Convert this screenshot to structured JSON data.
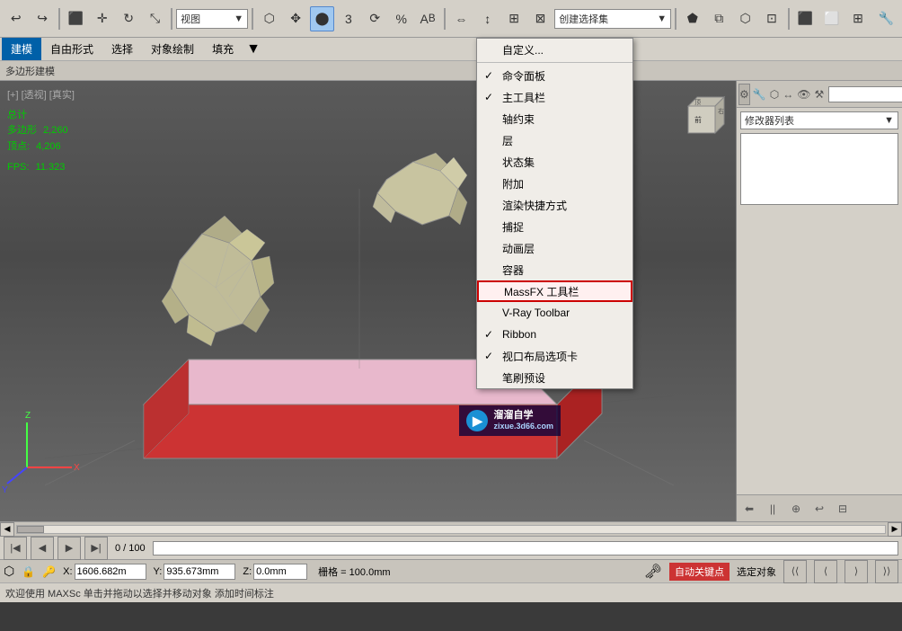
{
  "topToolbar": {
    "viewDropdown": "视图",
    "createDropdown": "创建选择集"
  },
  "menuBar": {
    "items": [
      "建模",
      "自由形式",
      "选择",
      "对象绘制",
      "填充"
    ]
  },
  "breadcrumb": {
    "text": "多边形建模"
  },
  "viewport": {
    "label": "[+] [透视] [真实]"
  },
  "leftInfo": {
    "totalLabel": "总计",
    "polyLabel": "多边形",
    "polyValue": "2,260",
    "vertLabel": "顶点:",
    "vertValue": "4,206",
    "fpsLabel": "FPS:",
    "fpsValue": "11.323"
  },
  "rightPanel": {
    "modifierDropdown": "修改器列表"
  },
  "dropdownMenu": {
    "items": [
      {
        "id": "customize",
        "label": "自定义...",
        "check": false,
        "separator_before": false,
        "highlighted": false
      },
      {
        "id": "command-panel",
        "label": "命令面板",
        "check": true,
        "separator_before": false,
        "highlighted": false
      },
      {
        "id": "main-toolbar",
        "label": "主工具栏",
        "check": true,
        "separator_before": false,
        "highlighted": false
      },
      {
        "id": "axis-constraints",
        "label": "轴约束",
        "check": false,
        "separator_before": false,
        "highlighted": false
      },
      {
        "id": "layer",
        "label": "层",
        "check": false,
        "separator_before": false,
        "highlighted": false
      },
      {
        "id": "state-sets",
        "label": "状态集",
        "check": false,
        "separator_before": false,
        "highlighted": false
      },
      {
        "id": "attach",
        "label": "附加",
        "check": false,
        "separator_before": false,
        "highlighted": false
      },
      {
        "id": "render-shortcut",
        "label": "渲染快捷方式",
        "check": false,
        "separator_before": false,
        "highlighted": false
      },
      {
        "id": "snaps",
        "label": "捕捉",
        "check": false,
        "separator_before": false,
        "highlighted": false
      },
      {
        "id": "animation-layers",
        "label": "动画层",
        "check": false,
        "separator_before": false,
        "highlighted": false
      },
      {
        "id": "containers",
        "label": "容器",
        "check": false,
        "separator_before": false,
        "highlighted": false
      },
      {
        "id": "massfx-toolbar",
        "label": "MassFX 工具栏",
        "check": false,
        "separator_before": false,
        "highlighted": true
      },
      {
        "id": "vray-toolbar",
        "label": "V-Ray Toolbar",
        "check": false,
        "separator_before": false,
        "highlighted": false
      },
      {
        "id": "ribbon",
        "label": "Ribbon",
        "check": true,
        "separator_before": false,
        "highlighted": false
      },
      {
        "id": "viewport-options",
        "label": "视口布局选项卡",
        "check": true,
        "separator_before": false,
        "highlighted": false
      },
      {
        "id": "brush-presets",
        "label": "笔刷预设",
        "check": false,
        "separator_before": false,
        "highlighted": false
      }
    ]
  },
  "timeline": {
    "value": "0 / 100"
  },
  "statusBar": {
    "xLabel": "X:",
    "xValue": "1606.682m",
    "yLabel": "Y:",
    "yValue": "935.673mm",
    "zLabel": "Z:",
    "zValue": "0.0mm",
    "gridLabel": "栅格 = 100.0mm",
    "autoKeyLabel": "自动关键点",
    "selectLabel": "选定对象"
  },
  "helpBar": {
    "text": "欢迎使用 MAXSc   单击并拖动以选择并移动对象    添加时间标注"
  },
  "watermark": {
    "line1": "溜溜自学",
    "line2": "zixue.3d66.com"
  }
}
